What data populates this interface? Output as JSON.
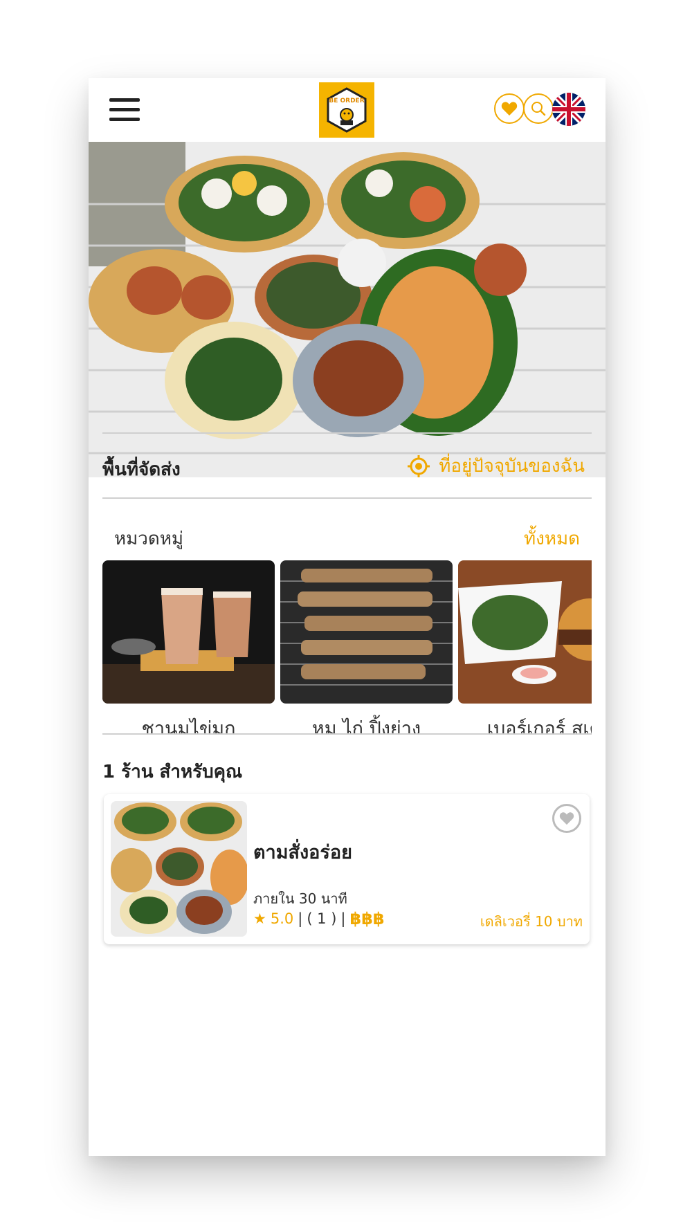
{
  "header": {
    "menu_icon": "hamburger-menu-icon",
    "logo_text": "BE ORDER",
    "favorites_icon": "heart-icon",
    "search_icon": "search-icon",
    "language_icon": "uk-flag-icon"
  },
  "delivery": {
    "label": "พื้นที่จัดส่ง",
    "location_icon": "location-target-icon",
    "location_text": "ที่อยู่ปัจจุบันของฉัน"
  },
  "categories": {
    "title": "หมวดหมู่",
    "see_all": "ทั้งหมด",
    "items": [
      {
        "label": "ชานมไข่มุก"
      },
      {
        "label": "หมู ไก่ ปิ้งย่าง"
      },
      {
        "label": "เบอร์เกอร์ สเต"
      }
    ]
  },
  "recommend": {
    "title": "1 ร้าน สำหรับคุณ",
    "restaurant": {
      "name": "ตามสั่งอร่อย",
      "time": "ภายใน 30 นาที",
      "rating": "5.0",
      "separator": "|",
      "reviews": "( 1 )",
      "price_level": "฿฿฿",
      "delivery_fee": "เดลิเวอรี่ 10 บาท",
      "favorite_icon": "heart-outline-icon"
    }
  },
  "colors": {
    "accent": "#f0a800",
    "text": "#222222"
  }
}
